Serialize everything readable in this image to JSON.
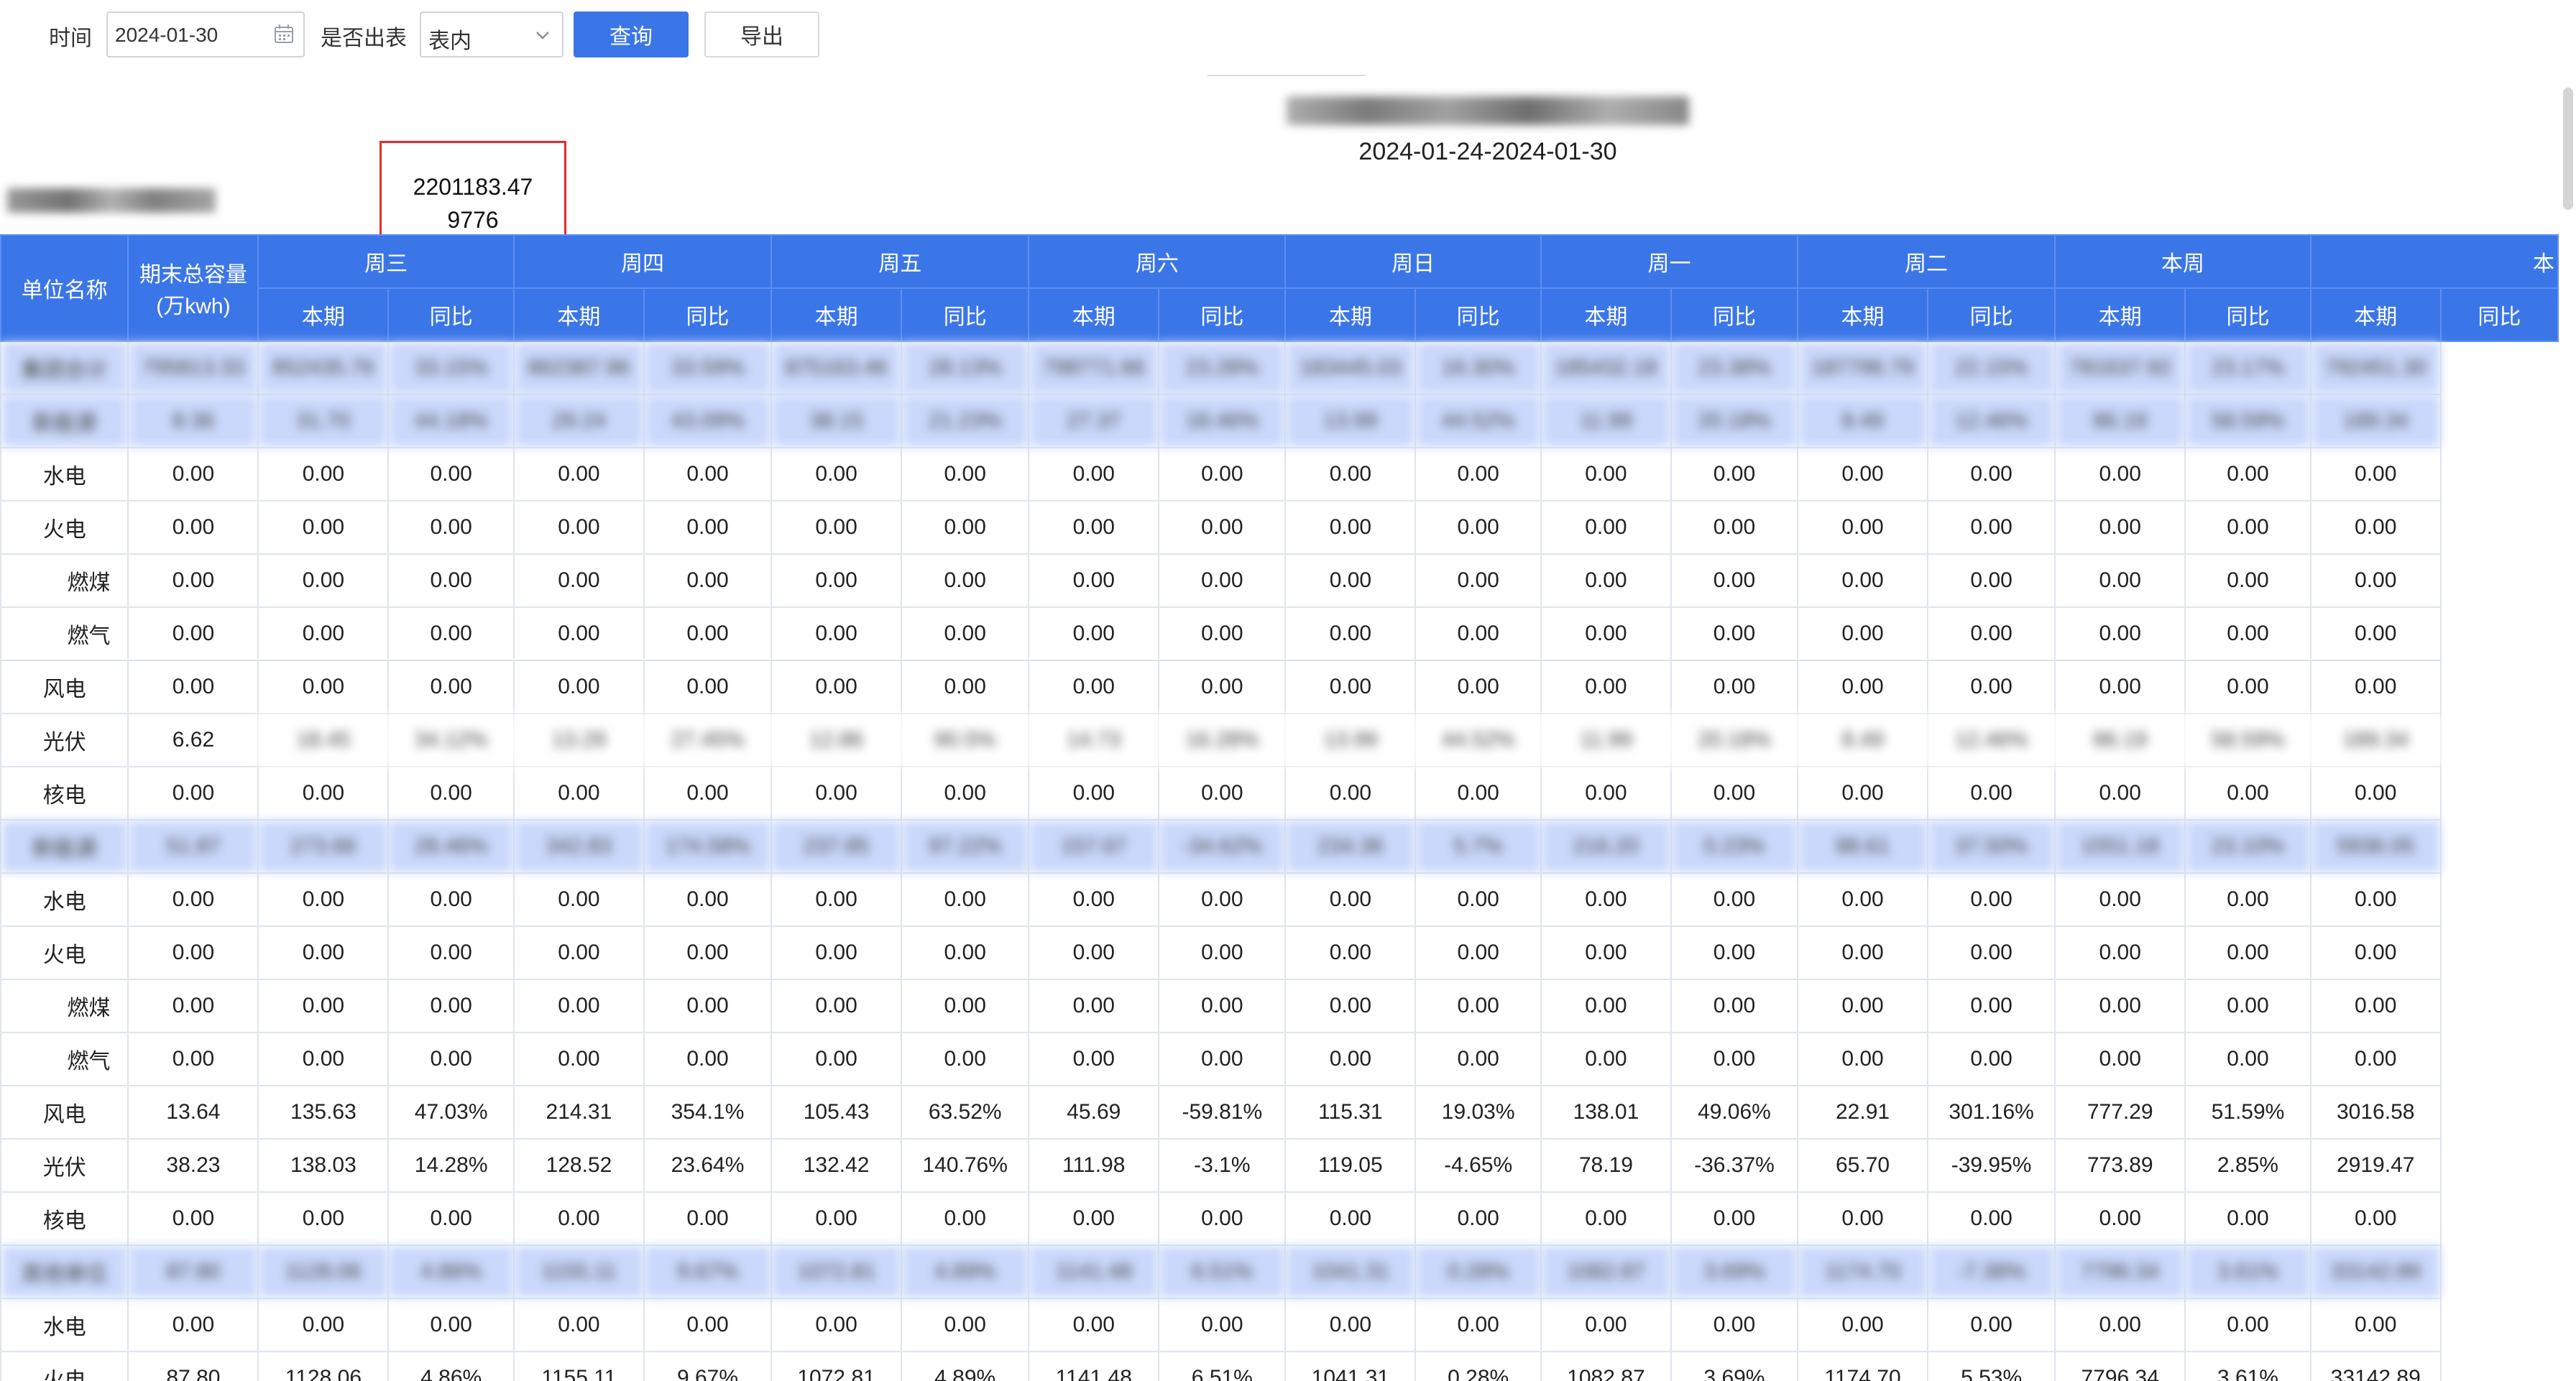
{
  "toolbar": {
    "time_label": "时间",
    "date_value": "2024-01-30",
    "output_label": "是否出表",
    "output_value": "表内",
    "query_label": "查询",
    "export_label": "导出"
  },
  "report": {
    "date_range": "2024-01-24-2024-01-30",
    "highlight_value_1": "2201183.47",
    "highlight_value_2": "9776"
  },
  "table": {
    "header_unit": "单位名称",
    "header_capacity": "期末总容量(万kwh)",
    "days": [
      "周三",
      "周四",
      "周五",
      "周六",
      "周日",
      "周一",
      "周二",
      "本周",
      "本"
    ],
    "sub_current": "本期",
    "sub_yoy": "同比",
    "rows": [
      {
        "type": "group",
        "cells": [
          "集团合计",
          "795813.33",
          "852435.76",
          "33.15%",
          "862387.96",
          "33.59%",
          "875163.46",
          "28.13%",
          "798771.66",
          "23.28%",
          "183445.03",
          "16.30%",
          "185432.18",
          "23.38%",
          "187796.79",
          "22.15%",
          "781637.92",
          "23.17%",
          "792451.30"
        ]
      },
      {
        "type": "group",
        "cells": [
          "新能源",
          "8.36",
          "31.70",
          "44.18%",
          "29.24",
          "43.09%",
          "38.15",
          "21.23%",
          "27.37",
          "18.46%",
          "13.99",
          "44.52%",
          "11.99",
          "20.18%",
          "8.49",
          "12.46%",
          "86.19",
          "58.59%",
          "189.34"
        ]
      },
      {
        "type": "row",
        "sub": false,
        "cells": [
          "水电",
          "0.00",
          "0.00",
          "0.00",
          "0.00",
          "0.00",
          "0.00",
          "0.00",
          "0.00",
          "0.00",
          "0.00",
          "0.00",
          "0.00",
          "0.00",
          "0.00",
          "0.00",
          "0.00",
          "0.00",
          "0.00"
        ]
      },
      {
        "type": "row",
        "sub": false,
        "cells": [
          "火电",
          "0.00",
          "0.00",
          "0.00",
          "0.00",
          "0.00",
          "0.00",
          "0.00",
          "0.00",
          "0.00",
          "0.00",
          "0.00",
          "0.00",
          "0.00",
          "0.00",
          "0.00",
          "0.00",
          "0.00",
          "0.00"
        ]
      },
      {
        "type": "row",
        "sub": true,
        "cells": [
          "燃煤",
          "0.00",
          "0.00",
          "0.00",
          "0.00",
          "0.00",
          "0.00",
          "0.00",
          "0.00",
          "0.00",
          "0.00",
          "0.00",
          "0.00",
          "0.00",
          "0.00",
          "0.00",
          "0.00",
          "0.00",
          "0.00"
        ]
      },
      {
        "type": "row",
        "sub": true,
        "cells": [
          "燃气",
          "0.00",
          "0.00",
          "0.00",
          "0.00",
          "0.00",
          "0.00",
          "0.00",
          "0.00",
          "0.00",
          "0.00",
          "0.00",
          "0.00",
          "0.00",
          "0.00",
          "0.00",
          "0.00",
          "0.00",
          "0.00"
        ]
      },
      {
        "type": "row",
        "sub": false,
        "cells": [
          "风电",
          "0.00",
          "0.00",
          "0.00",
          "0.00",
          "0.00",
          "0.00",
          "0.00",
          "0.00",
          "0.00",
          "0.00",
          "0.00",
          "0.00",
          "0.00",
          "0.00",
          "0.00",
          "0.00",
          "0.00",
          "0.00"
        ]
      },
      {
        "type": "row",
        "sub": false,
        "cells": [
          "光伏",
          "6.62",
          "18.45",
          "34.12%",
          "13.29",
          "27.45%",
          "12.86",
          "90.5%",
          "14.73",
          "16.28%",
          "13.99",
          "44.52%",
          "11.99",
          "20.18%",
          "8.49",
          "12.46%",
          "86.19",
          "58.59%",
          "189.34"
        ]
      },
      {
        "type": "row",
        "sub": false,
        "cells": [
          "核电",
          "0.00",
          "0.00",
          "0.00",
          "0.00",
          "0.00",
          "0.00",
          "0.00",
          "0.00",
          "0.00",
          "0.00",
          "0.00",
          "0.00",
          "0.00",
          "0.00",
          "0.00",
          "0.00",
          "0.00",
          "0.00"
        ]
      },
      {
        "type": "group",
        "cells": [
          "新能源",
          "51.87",
          "273.66",
          "28.46%",
          "342.83",
          "174.58%",
          "237.85",
          "97.22%",
          "157.67",
          "-34.62%",
          "234.36",
          "5.7%",
          "216.20",
          "0.23%",
          "88.61",
          "37.50%",
          "1551.18",
          "23.10%",
          "5936.05"
        ]
      },
      {
        "type": "row",
        "sub": false,
        "cells": [
          "水电",
          "0.00",
          "0.00",
          "0.00",
          "0.00",
          "0.00",
          "0.00",
          "0.00",
          "0.00",
          "0.00",
          "0.00",
          "0.00",
          "0.00",
          "0.00",
          "0.00",
          "0.00",
          "0.00",
          "0.00",
          "0.00"
        ]
      },
      {
        "type": "row",
        "sub": false,
        "cells": [
          "火电",
          "0.00",
          "0.00",
          "0.00",
          "0.00",
          "0.00",
          "0.00",
          "0.00",
          "0.00",
          "0.00",
          "0.00",
          "0.00",
          "0.00",
          "0.00",
          "0.00",
          "0.00",
          "0.00",
          "0.00",
          "0.00"
        ]
      },
      {
        "type": "row",
        "sub": true,
        "cells": [
          "燃煤",
          "0.00",
          "0.00",
          "0.00",
          "0.00",
          "0.00",
          "0.00",
          "0.00",
          "0.00",
          "0.00",
          "0.00",
          "0.00",
          "0.00",
          "0.00",
          "0.00",
          "0.00",
          "0.00",
          "0.00",
          "0.00"
        ]
      },
      {
        "type": "row",
        "sub": true,
        "cells": [
          "燃气",
          "0.00",
          "0.00",
          "0.00",
          "0.00",
          "0.00",
          "0.00",
          "0.00",
          "0.00",
          "0.00",
          "0.00",
          "0.00",
          "0.00",
          "0.00",
          "0.00",
          "0.00",
          "0.00",
          "0.00",
          "0.00"
        ]
      },
      {
        "type": "row",
        "sub": false,
        "cells": [
          "风电",
          "13.64",
          "135.63",
          "47.03%",
          "214.31",
          "354.1%",
          "105.43",
          "63.52%",
          "45.69",
          "-59.81%",
          "115.31",
          "19.03%",
          "138.01",
          "49.06%",
          "22.91",
          "301.16%",
          "777.29",
          "51.59%",
          "3016.58"
        ]
      },
      {
        "type": "row",
        "sub": false,
        "cells": [
          "光伏",
          "38.23",
          "138.03",
          "14.28%",
          "128.52",
          "23.64%",
          "132.42",
          "140.76%",
          "111.98",
          "-3.1%",
          "119.05",
          "-4.65%",
          "78.19",
          "-36.37%",
          "65.70",
          "-39.95%",
          "773.89",
          "2.85%",
          "2919.47"
        ]
      },
      {
        "type": "row",
        "sub": false,
        "cells": [
          "核电",
          "0.00",
          "0.00",
          "0.00",
          "0.00",
          "0.00",
          "0.00",
          "0.00",
          "0.00",
          "0.00",
          "0.00",
          "0.00",
          "0.00",
          "0.00",
          "0.00",
          "0.00",
          "0.00",
          "0.00",
          "0.00"
        ]
      },
      {
        "type": "group",
        "cells": [
          "其他单位",
          "87.80",
          "1128.06",
          "4.86%",
          "1155.11",
          "9.67%",
          "1072.81",
          "4.89%",
          "1141.48",
          "6.51%",
          "1041.31",
          "0.28%",
          "1082.87",
          "3.69%",
          "1174.70",
          "-7.38%",
          "7796.34",
          "3.61%",
          "33142.89"
        ]
      },
      {
        "type": "row",
        "sub": false,
        "cells": [
          "水电",
          "0.00",
          "0.00",
          "0.00",
          "0.00",
          "0.00",
          "0.00",
          "0.00",
          "0.00",
          "0.00",
          "0.00",
          "0.00",
          "0.00",
          "0.00",
          "0.00",
          "0.00",
          "0.00",
          "0.00",
          "0.00"
        ]
      },
      {
        "type": "row",
        "sub": false,
        "cells": [
          "火电",
          "87.80",
          "1128.06",
          "4.86%",
          "1155.11",
          "9.67%",
          "1072.81",
          "4.89%",
          "1141.48",
          "6.51%",
          "1041.31",
          "0.28%",
          "1082.87",
          "3.69%",
          "1174.70",
          "5.53%",
          "7796.34",
          "3.61%",
          "33142.89"
        ]
      }
    ]
  },
  "colors": {
    "primary": "#3b76e8",
    "group_row": "#c9d8fb",
    "highlight": "#e52b2b"
  }
}
